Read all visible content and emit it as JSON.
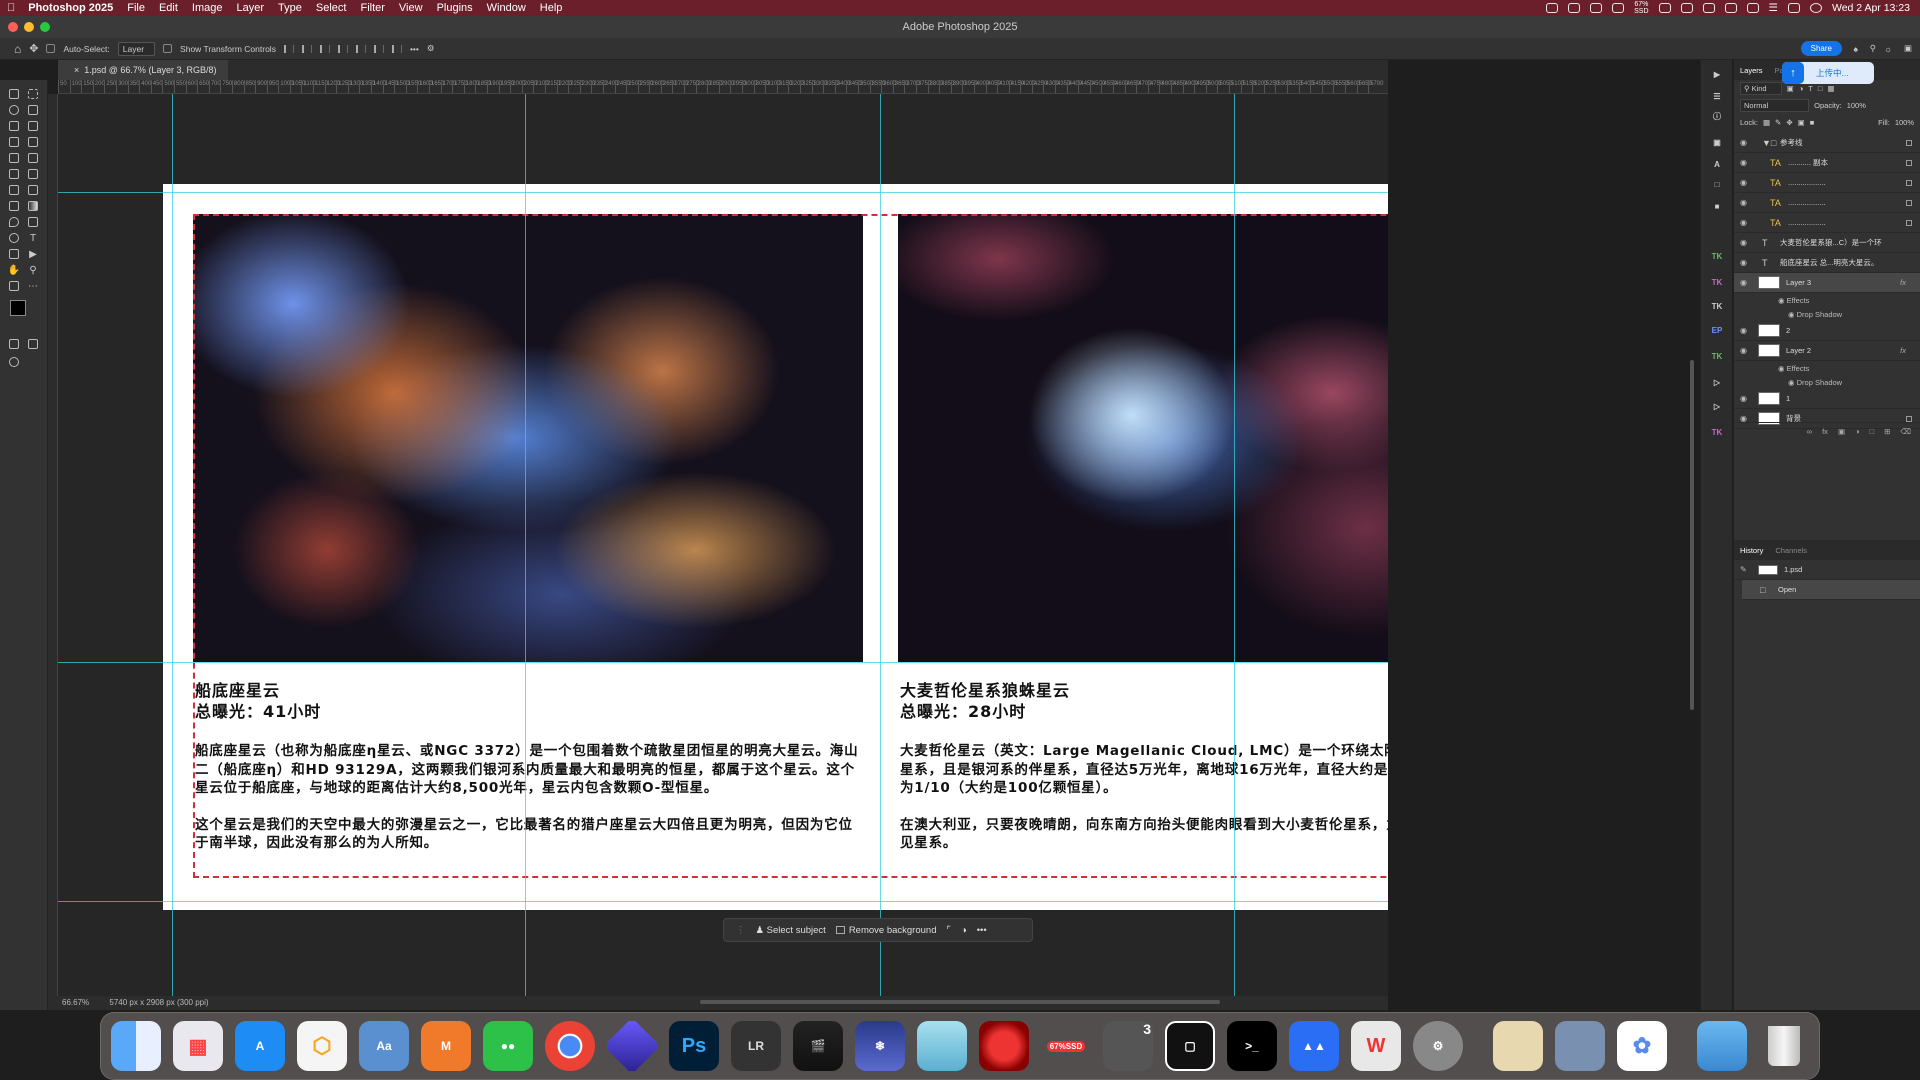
{
  "menubar": {
    "app": "Photoshop 2025",
    "items": [
      "File",
      "Edit",
      "Image",
      "Layer",
      "Type",
      "Select",
      "Filter",
      "View",
      "Plugins",
      "Window",
      "Help"
    ],
    "battery": "67%",
    "battery_sub": "SSD",
    "datetime": "Wed 2 Apr  13:23"
  },
  "window": {
    "title": "Adobe Photoshop 2025"
  },
  "options": {
    "auto_select_label": "Auto-Select:",
    "auto_select_value": "Layer",
    "transform_label": "Show Transform Controls",
    "more": "•••",
    "share": "Share"
  },
  "doc_tab": {
    "title": "1.psd @ 66.7% (Layer 3, RGB/8)"
  },
  "ruler": {
    "ticks": [
      "50",
      "100",
      "150",
      "200",
      "250",
      "300",
      "350",
      "400",
      "450",
      "500",
      "550",
      "600",
      "650",
      "700",
      "750",
      "800",
      "850",
      "900",
      "950",
      "1000",
      "1050",
      "1100",
      "1150",
      "1200",
      "1250",
      "1300",
      "1350",
      "1400",
      "1450",
      "1500",
      "1550",
      "1600",
      "1650",
      "1700",
      "1750",
      "1800",
      "1850",
      "1900",
      "1950",
      "2000",
      "2050",
      "2100",
      "2150",
      "2200",
      "2250",
      "2300",
      "2350",
      "2400",
      "2450",
      "2500",
      "2550",
      "2600",
      "2650",
      "2700",
      "2750",
      "2800",
      "2850",
      "2900",
      "2950",
      "3000",
      "3050",
      "3100",
      "3150",
      "3200",
      "3250",
      "3300",
      "3350",
      "3400",
      "3450",
      "3500",
      "3550",
      "3600",
      "3650",
      "3700",
      "3750",
      "3800",
      "3850",
      "3900",
      "3950",
      "4000",
      "4050",
      "4100",
      "4150",
      "4200",
      "4250",
      "4300",
      "4350",
      "4400",
      "4450",
      "4500",
      "4550",
      "4600",
      "4650",
      "4700",
      "4750",
      "4800",
      "4850",
      "4900",
      "4950",
      "5000",
      "5050",
      "5100",
      "5150",
      "5200",
      "5250",
      "5300",
      "5350",
      "5400",
      "5450",
      "5500",
      "5550",
      "5600",
      "5650",
      "5700"
    ]
  },
  "cards": [
    {
      "title": "船底座星云",
      "exposure": "总曝光：41小时",
      "paragraphs": [
        "船底座星云（也称为船底座η星云、或NGC 3372）是一个包围着数个疏散星团恒星的明亮大星云。海山二（船底座η）和HD 93129A，这两颗我们银河系内质量最大和最明亮的恒星，都属于这个星云。这个星云位于船底座，与地球的距离估计大约8,500光年，星云内包含数颗O-型恒星。",
        "这个星云是我们的天空中最大的弥漫星云之一，它比最著名的猎户座星云大四倍且更为明亮，但因为它位于南半球，因此没有那么的为人所知。"
      ]
    },
    {
      "title": "大麦哲伦星系狼蛛星云",
      "exposure": "总曝光：28小时",
      "paragraphs": [
        "大麦哲伦星云（英文：Large Magellanic Cloud, LMC）是一个环绕太阳所在的银河外运转的河外星系，且是银河系的伴星系，直径达5万光年，离地球16万光年，直径大约是银河系个1/20，恒星数量约为1/10（大约是100亿颗恒星）。",
        "在澳大利亚，只要夜晚晴朗，向东南方向抬头便能肉眼看到大小麦哲伦星系，为南半球全天最大最亮的可见星系。"
      ]
    }
  ],
  "contextbar": {
    "select_subject": "Select subject",
    "remove_background": "Remove background",
    "more": "•••"
  },
  "status": {
    "zoom": "66.67%",
    "doc_size": "5740 px x 2908 px (300 ppi)"
  },
  "upload": {
    "label": "上传中..."
  },
  "layers_panel": {
    "tabs": [
      "Layers",
      "Pat"
    ],
    "kind": "Kind",
    "blend": "Normal",
    "opacity_label": "Opacity:",
    "opacity": "100%",
    "lock_label": "Lock:",
    "fill_label": "Fill:",
    "fill": "100%",
    "effects_label": "Effects",
    "drop_shadow_label": "Drop Shadow",
    "layers": [
      {
        "name": "参考线",
        "type": "group"
      },
      {
        "name": "...........  副本",
        "type": "text-fx"
      },
      {
        "name": "..................",
        "type": "text-fx"
      },
      {
        "name": "..................",
        "type": "text-fx"
      },
      {
        "name": "..................",
        "type": "text-fx"
      },
      {
        "name": "大麦哲伦星系狼...C）是一个环",
        "type": "text"
      },
      {
        "name": "船底座星云 总...明亮大星云。",
        "type": "text"
      },
      {
        "name": "Layer 3",
        "type": "pixel",
        "selected": true,
        "fx": true
      },
      {
        "name": "2",
        "type": "pixel"
      },
      {
        "name": "Layer 2",
        "type": "pixel",
        "fx": true
      },
      {
        "name": "1",
        "type": "pixel"
      },
      {
        "name": "背景",
        "type": "pixel",
        "locked": true
      }
    ]
  },
  "history_panel": {
    "tabs": [
      "History",
      "Channels"
    ],
    "snapshot": "1.psd",
    "items": [
      "Open"
    ]
  },
  "dock": {
    "badge_text": "67%SSD",
    "badge_num": "3",
    "apps": [
      "Finder",
      "Launchpad",
      "App Store",
      "Sketchbook",
      "Dictionary",
      "Mindnode",
      "WeChat",
      "Chrome",
      "Gem",
      "Photoshop",
      "LRTimelapse",
      "Final Cut",
      "Snowflake",
      "Files",
      "Red Ball",
      "Game",
      "Camera",
      "Frame",
      "Terminal",
      "Cloud",
      "WPS",
      "Settings",
      "Archive",
      "Preview",
      "Photos",
      "Folder",
      "Trash"
    ],
    "ps_label": "Ps",
    "lr_label": "LR"
  },
  "colors": {
    "menubar": "#6b1f2a",
    "guide": "#35d0e0",
    "selection": "#d0303a",
    "accent": "#1473e6"
  }
}
